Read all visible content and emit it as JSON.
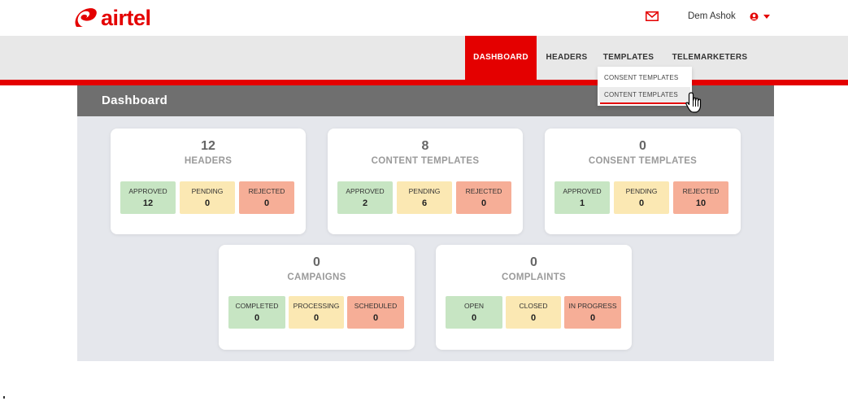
{
  "brand": {
    "name": "airtel",
    "color": "#e40000"
  },
  "user": {
    "name": "Dem Ashok",
    "mail_icon": "mail-icon",
    "user_icon": "user-icon",
    "caret_icon": "caret-down-icon"
  },
  "nav": {
    "items": [
      {
        "label": "DASHBOARD",
        "active": true
      },
      {
        "label": "HEADERS",
        "active": false
      },
      {
        "label": "TEMPLATES",
        "active": false
      },
      {
        "label": "TELEMARKETERS",
        "active": false
      }
    ]
  },
  "dropdown": {
    "items": [
      {
        "label": "CONSENT TEMPLATES"
      },
      {
        "label": "CONTENT TEMPLATES",
        "hover": true
      }
    ]
  },
  "panel": {
    "title": "Dashboard"
  },
  "cards": [
    {
      "count": "12",
      "title": "HEADERS",
      "stats": [
        {
          "label": "APPROVED",
          "value": "12"
        },
        {
          "label": "PENDING",
          "value": "0"
        },
        {
          "label": "REJECTED",
          "value": "0"
        }
      ]
    },
    {
      "count": "8",
      "title": "CONTENT TEMPLATES",
      "stats": [
        {
          "label": "APPROVED",
          "value": "2"
        },
        {
          "label": "PENDING",
          "value": "6"
        },
        {
          "label": "REJECTED",
          "value": "0"
        }
      ]
    },
    {
      "count": "0",
      "title": "CONSENT TEMPLATES",
      "stats": [
        {
          "label": "APPROVED",
          "value": "1"
        },
        {
          "label": "PENDING",
          "value": "0"
        },
        {
          "label": "REJECTED",
          "value": "10"
        }
      ]
    },
    {
      "count": "0",
      "title": "CAMPAIGNS",
      "stats": [
        {
          "label": "COMPLETED",
          "value": "0"
        },
        {
          "label": "PROCESSING",
          "value": "0"
        },
        {
          "label": "SCHEDULED",
          "value": "0"
        }
      ]
    },
    {
      "count": "0",
      "title": "COMPLAINTS",
      "stats": [
        {
          "label": "OPEN",
          "value": "0"
        },
        {
          "label": "CLOSED",
          "value": "0"
        },
        {
          "label": "IN PROGRESS",
          "value": "0"
        }
      ]
    }
  ],
  "colors": {
    "approved": "#c7e5c3",
    "pending": "#fbe8b3",
    "rejected": "#f6ae97",
    "header": "#6f6f6f"
  }
}
